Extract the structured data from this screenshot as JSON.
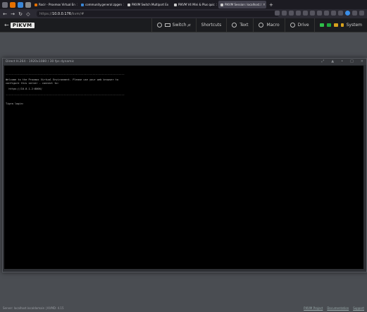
{
  "browser": {
    "tabs": [
      {
        "label": "Rocir - Proxmox Virtual En",
        "color": "#e57000",
        "active": false
      },
      {
        "label": "community.general.zpgen",
        "color": "#3a86d6",
        "active": false
      },
      {
        "label": "PiKVM Switch Multiport Ex",
        "color": "#cccccc",
        "active": false
      },
      {
        "label": "PiKVM V4 Mini & Plus quic",
        "color": "#cccccc",
        "active": false
      },
      {
        "label": "PiKVM Session: localhost.l",
        "color": "#cccccc",
        "active": true
      }
    ],
    "new_tab": "+",
    "url_scheme": "https://",
    "url_host": "10.0.0.176",
    "url_path": "/kvm/#"
  },
  "header": {
    "logo": "PiKVM",
    "menu": [
      {
        "label": "Switch",
        "suffix": "pt"
      },
      {
        "label": "Shortcuts",
        "suffix": ""
      },
      {
        "label": "Text",
        "suffix": ""
      },
      {
        "label": "Macro",
        "suffix": ""
      },
      {
        "label": "Drive",
        "suffix": ""
      },
      {
        "label": "System",
        "suffix": ""
      }
    ],
    "led_colors": [
      "#2fbf4a",
      "#1fa83c",
      "#d8a21c",
      "#d8a21c"
    ]
  },
  "stream_window": {
    "title": "Direct H.264 - 1920x1080 / 30 fps dynamic",
    "console_lines": [
      "------------------------------------------------------------------------------",
      "",
      "Welcome to the Proxmox Virtual Environment. Please use your web browser to",
      "configure this server - connect to:",
      "",
      "  https://10.0.1.2:8006/",
      "",
      "------------------------------------------------------------------------------",
      "",
      "",
      "Tigra login:"
    ]
  },
  "footer": {
    "left": "Server: localhost.localdomain  |  KVMD: 4.15",
    "links": [
      "PiKVM Project",
      "Documentation",
      "Support"
    ]
  }
}
